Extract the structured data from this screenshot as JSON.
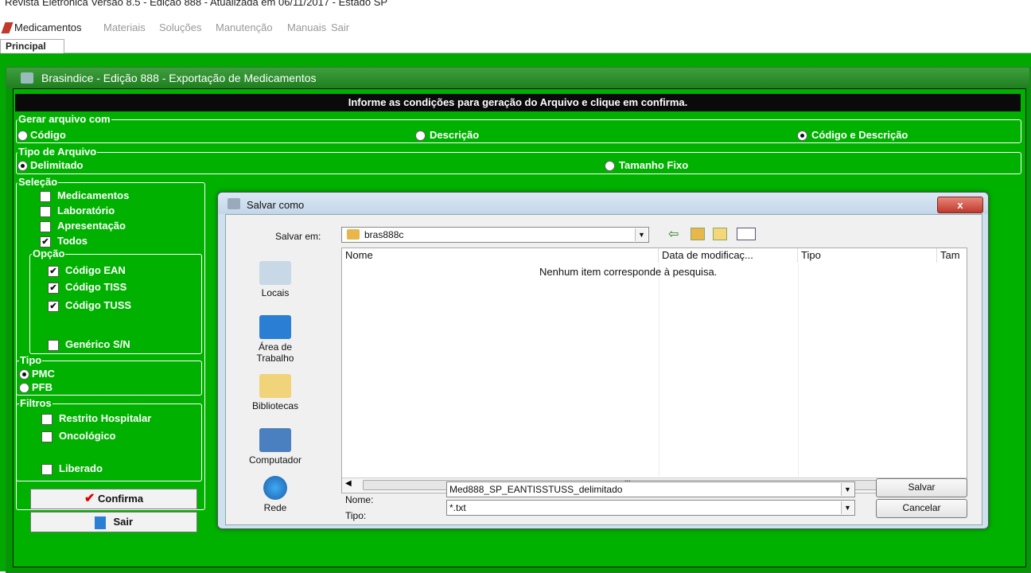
{
  "window_title": "Revista Eletronica Versão 8.5 - Edição 888 - Atualizada em 06/11/2017 - Estado SP",
  "menu": [
    "Medicamentos",
    "Materiais",
    "Soluções",
    "Manutenção",
    "Manuais",
    "Sair"
  ],
  "tab": "Principal",
  "form": {
    "title": "Brasindice - Edição 888 - Exportação de Medicamentos",
    "banner": "Informe as condições para geração do Arquivo e clique em confirma.",
    "gerar": {
      "legend": "Gerar arquivo com",
      "options": [
        "Código",
        "Descrição",
        "Código e Descrição"
      ],
      "selected": "Código e Descrição"
    },
    "tipo_arquivo": {
      "legend": "Tipo de Arquivo",
      "options": [
        "Delimitado",
        "Tamanho Fixo"
      ],
      "selected": "Delimitado"
    },
    "selecao": {
      "legend": "Seleção",
      "items": [
        {
          "label": "Medicamentos",
          "checked": false
        },
        {
          "label": "Laboratório",
          "checked": false
        },
        {
          "label": "Apresentação",
          "checked": false
        },
        {
          "label": "Todos",
          "checked": true
        }
      ]
    },
    "opcao": {
      "legend": "Opção",
      "items": [
        {
          "label": "Código EAN",
          "checked": true
        },
        {
          "label": "Código TISS",
          "checked": true
        },
        {
          "label": "Código TUSS",
          "checked": true
        },
        {
          "label": "Genérico S/N",
          "checked": false
        }
      ]
    },
    "tipo": {
      "legend": "Tipo",
      "options": [
        "PMC",
        "PFB"
      ],
      "selected": "PMC"
    },
    "filtros": {
      "legend": "Filtros",
      "items": [
        {
          "label": "Restrito Hospitalar",
          "checked": false
        },
        {
          "label": "Oncológico",
          "checked": false
        },
        {
          "label": "Liberado",
          "checked": false
        }
      ]
    },
    "confirm_label": "Confirma",
    "exit_label": "Sair"
  },
  "dialog": {
    "title": "Salvar como",
    "close_label": "x",
    "save_in_label": "Salvar em:",
    "folder": "bras888c",
    "places": [
      "Locais",
      "Área de Trabalho",
      "Bibliotecas",
      "Computador",
      "Rede"
    ],
    "columns": [
      "Nome",
      "Data de modificaç...",
      "Tipo",
      "Tam"
    ],
    "empty_message": "Nenhum item corresponde à pesquisa.",
    "scroll_grip": "III",
    "name_label": "Nome:",
    "name_value": "Med888_SP_EANTISSTUSS_delimitado",
    "type_label": "Tipo:",
    "type_value": "*.txt",
    "save_label": "Salvar",
    "cancel_label": "Cancelar"
  }
}
